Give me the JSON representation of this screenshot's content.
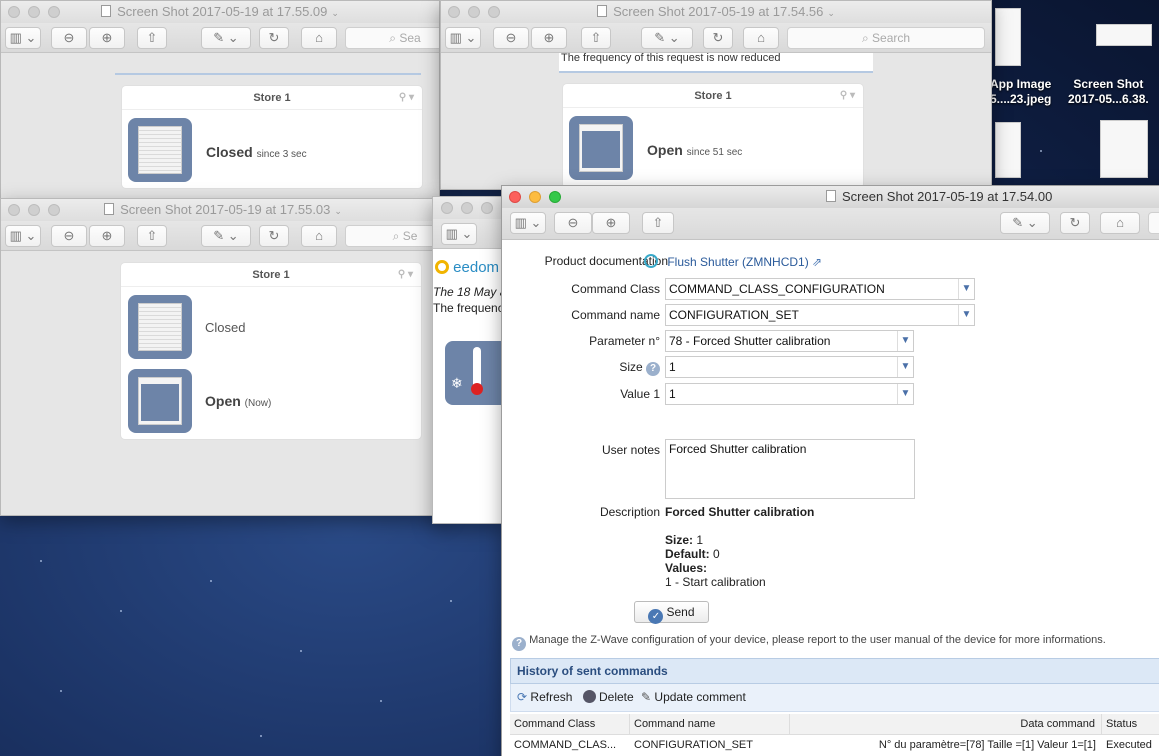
{
  "desktop": {
    "items": [
      {
        "line1": "App Image",
        "line2": "5....23.jpeg"
      },
      {
        "line1": "Screen Shot",
        "line2": "2017-05...6.38."
      }
    ]
  },
  "windows": {
    "w1": {
      "title": "Screen Shot 2017-05-19 at 17.55.09",
      "search": "Sea",
      "card": {
        "title": "Store 1",
        "state": "Closed",
        "since": "since 3 sec"
      }
    },
    "w2": {
      "title": "Screen Shot 2017-05-19 at 17.54.56",
      "search": "Search",
      "top_text": "The frequency of this request is now reduced",
      "card": {
        "title": "Store 1",
        "state": "Open",
        "since": "since 51 sec"
      }
    },
    "w3": {
      "title": "Screen Shot 2017-05-19 at 17.55.03",
      "search": "Se",
      "card": {
        "title": "Store 1",
        "state1": "Closed",
        "state2": "Open",
        "state2_note": "(Now)"
      }
    },
    "w4": {
      "brand": "eedom",
      "line1": "The 18 May a",
      "line2": "The frequenc"
    }
  },
  "main": {
    "title": "Screen Shot 2017-05-19 at 17.54.00",
    "product_doc_label": "Product documentation",
    "product_link": "Flush Shutter (ZMNHCD1)",
    "fields": {
      "command_class": {
        "label": "Command Class",
        "value": "COMMAND_CLASS_CONFIGURATION"
      },
      "command_name": {
        "label": "Command name",
        "value": "CONFIGURATION_SET"
      },
      "parameter": {
        "label": "Parameter n°",
        "value": "78 - Forced Shutter calibration"
      },
      "size": {
        "label": "Size",
        "value": "1"
      },
      "value1": {
        "label": "Value 1",
        "value": "1"
      },
      "user_notes": {
        "label": "User notes",
        "value": "Forced Shutter calibration"
      }
    },
    "description": {
      "label": "Description",
      "title": "Forced Shutter calibration",
      "size_label": "Size:",
      "size_value": "1",
      "default_label": "Default:",
      "default_value": "0",
      "values_label": "Values:",
      "values_item": "1 - Start calibration"
    },
    "send_label": "Send",
    "help_text": "Manage the Z-Wave configuration of your device, please report to the user manual of the device for more informations.",
    "history": {
      "title": "History of sent commands",
      "refresh": "Refresh",
      "delete": "Delete",
      "update": "Update comment",
      "columns": [
        "Command Class",
        "Command name",
        "Data command",
        "Status"
      ],
      "rows": [
        [
          "COMMAND_CLAS...",
          "CONFIGURATION_SET",
          "N° du paramètre=[78] Taille =[1] Valeur 1=[1]",
          "Executed"
        ]
      ]
    }
  }
}
